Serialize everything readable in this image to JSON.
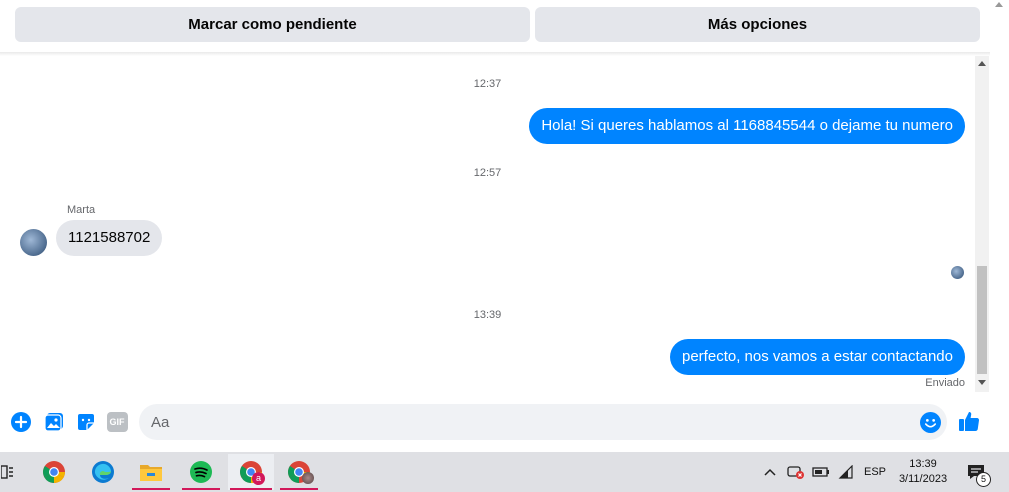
{
  "top_buttons": {
    "mark_pending": "Marcar como pendiente",
    "more_options": "Más opciones"
  },
  "conversation": {
    "timestamps": [
      "12:37",
      "12:57",
      "13:39"
    ],
    "messages": [
      {
        "direction": "out",
        "text": "Hola! Si queres hablamos al 1168845544 o dejame tu numero"
      },
      {
        "sender": "Marta",
        "direction": "in",
        "text": "1121588702"
      },
      {
        "direction": "out",
        "text": "perfecto, nos vamos a estar contactando"
      }
    ],
    "delivery_status": "Enviado"
  },
  "composer": {
    "placeholder": "Aa",
    "icons": [
      "plus-circle-icon",
      "image-icon",
      "sticker-icon",
      "gif-icon",
      "emoji-icon",
      "thumbs-up-icon"
    ],
    "gif_label": "GIF"
  },
  "taskbar": {
    "apps": [
      "task-view-icon",
      "chrome-icon",
      "edge-icon",
      "file-explorer-icon",
      "spotify-icon",
      "chrome-profile-a-icon",
      "chrome-profile-photo-icon"
    ],
    "profile_badge": "a",
    "tray": {
      "language": "ESP",
      "time": "13:39",
      "date": "3/11/2023",
      "notification_count": "5"
    }
  },
  "colors": {
    "brand_blue": "#0084ff",
    "incoming_bubble": "#e4e6eb",
    "button_grey": "#e4e6eb",
    "taskbar": "#dfe0e4",
    "app_underline": "#d2185a"
  }
}
